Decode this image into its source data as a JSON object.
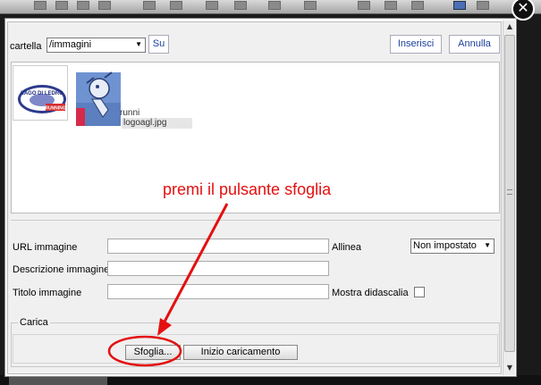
{
  "toolbar": {},
  "dialog": {
    "close_glyph": "✕",
    "folder_label": "cartella",
    "folder_value": "/immagini",
    "up_label": "Su",
    "insert_label": "Inserisci",
    "cancel_label": "Annulla"
  },
  "files": [
    {
      "name": "runni",
      "kind": "image"
    },
    {
      "name": "logoagl.jpg",
      "kind": "image"
    }
  ],
  "logo_text": {
    "top": "LAGO DI LEDRO",
    "bottom": "RUNNING"
  },
  "properties": {
    "url_label": "URL immagine",
    "url_value": "",
    "description_label": "Descrizione immagine",
    "description_value": "",
    "title_label": "Titolo immagine",
    "title_value": "",
    "align_label": "Allinea",
    "align_value": "Non impostato",
    "caption_label": "Mostra didascalia",
    "caption_checked": false
  },
  "upload": {
    "legend": "Carica",
    "browse_label": "Sfoglia...",
    "start_label": "Inizio caricamento"
  },
  "annotation": {
    "text": "premi il pulsante sfoglia",
    "color": "#e41010"
  }
}
